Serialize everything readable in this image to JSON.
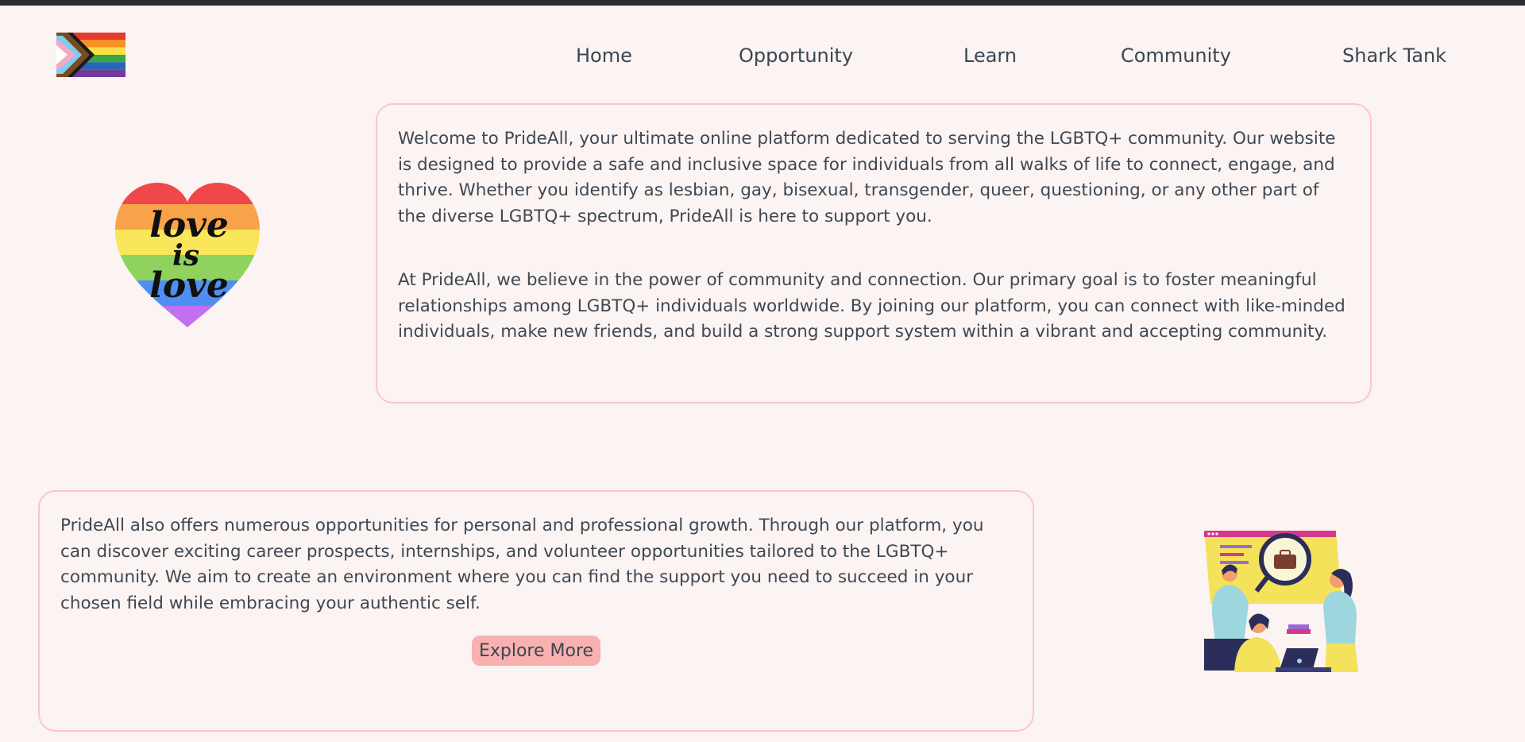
{
  "nav": {
    "items": [
      {
        "label": "Home"
      },
      {
        "label": "Opportunity"
      },
      {
        "label": "Learn"
      },
      {
        "label": "Community"
      },
      {
        "label": "Shark Tank"
      }
    ]
  },
  "intro": {
    "paragraph1": "Welcome to PrideAll, your ultimate online platform dedicated to serving the LGBTQ+ community. Our website is designed to provide a safe and inclusive space for individuals from all walks of life to connect, engage, and thrive. Whether you identify as lesbian, gay, bisexual, transgender, queer, questioning, or any other part of the diverse LGBTQ+ spectrum, PrideAll is here to support you.",
    "paragraph2": "At PrideAll, we believe in the power of community and connection. Our primary goal is to foster meaningful relationships among LGBTQ+ individuals worldwide. By joining our platform, you can connect with like-minded individuals, make new friends, and build a strong support system within a vibrant and accepting community."
  },
  "opportunity": {
    "paragraph": "PrideAll also offers numerous opportunities for personal and professional growth. Through our platform, you can discover exciting career prospects, internships, and volunteer opportunities tailored to the LGBTQ+ community. We aim to create an environment where you can find the support you need to succeed in your chosen field while embracing your authentic self.",
    "button_label": "Explore More"
  },
  "images": {
    "logo": "progress-pride-flag",
    "heart": "love-is-love-rainbow-heart",
    "heart_text": [
      "love",
      "is",
      "love"
    ],
    "illustration": "team-career-search-illustration"
  },
  "colors": {
    "background": "#fcf3f3",
    "card_border": "#fbc7c7",
    "button_bg": "#f9b0b0",
    "text": "#3e4853"
  }
}
